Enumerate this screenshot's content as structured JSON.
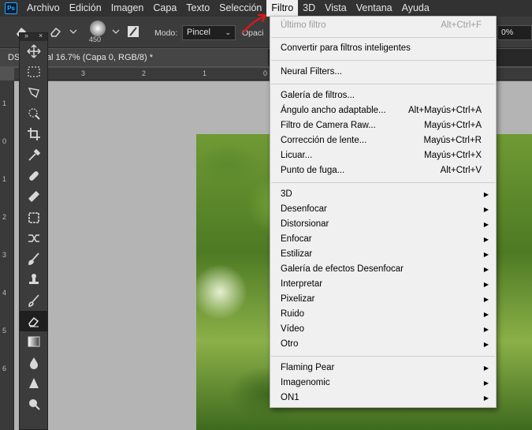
{
  "app": {
    "logo_text": "Ps"
  },
  "menubar": {
    "items": [
      "Archivo",
      "Edición",
      "Imagen",
      "Capa",
      "Texto",
      "Selección",
      "Filtro",
      "3D",
      "Vista",
      "Ventana",
      "Ayuda"
    ],
    "active": "Filtro"
  },
  "options": {
    "brush_size": "450",
    "modo_label": "Modo:",
    "modo_value": "Pincel",
    "opacity_label": "Opaci",
    "percent_value": "0%"
  },
  "document": {
    "tab_title": "DS...JPG al 16.7% (Capa 0, RGB/8) *"
  },
  "rulers": {
    "top": [
      "3",
      "2",
      "1",
      "0"
    ],
    "left": [
      "1",
      "0",
      "1",
      "2",
      "3",
      "4",
      "5",
      "6"
    ]
  },
  "tools": [
    "move-tool",
    "marquee-tool",
    "lasso-tool",
    "quick-select-tool",
    "crop-tool",
    "eyedropper-tool",
    "spot-healing-tool",
    "healing-brush-tool",
    "patch-tool",
    "content-move-tool",
    "brush-tool",
    "stamp-tool",
    "history-brush-tool",
    "eraser-tool",
    "gradient-tool",
    "blur-tool",
    "sharpen-tool",
    "smudge-tool"
  ],
  "filter_menu": {
    "last_filter": {
      "label": "Último filtro",
      "shortcut": "Alt+Ctrl+F"
    },
    "smart_filters": "Convertir para filtros inteligentes",
    "neural": "Neural Filters...",
    "group1": [
      {
        "label": "Galería de filtros...",
        "shortcut": ""
      },
      {
        "label": "Ángulo ancho adaptable...",
        "shortcut": "Alt+Mayús+Ctrl+A"
      },
      {
        "label": "Filtro de Camera Raw...",
        "shortcut": "Mayús+Ctrl+A"
      },
      {
        "label": "Corrección de lente...",
        "shortcut": "Mayús+Ctrl+R"
      },
      {
        "label": "Licuar...",
        "shortcut": "Mayús+Ctrl+X"
      },
      {
        "label": "Punto de fuga...",
        "shortcut": "Alt+Ctrl+V"
      }
    ],
    "submenus": [
      "3D",
      "Desenfocar",
      "Distorsionar",
      "Enfocar",
      "Estilizar",
      "Galería de efectos Desenfocar",
      "Interpretar",
      "Pixelizar",
      "Ruido",
      "Vídeo",
      "Otro"
    ],
    "plugins": [
      "Flaming Pear",
      "Imagenomic",
      "ON1"
    ],
    "submenu_arrow": "▶"
  },
  "colors": {
    "menu_bg": "#f0f0f0",
    "accent_arrow": "#d01c1c",
    "workspace": "#535353"
  }
}
